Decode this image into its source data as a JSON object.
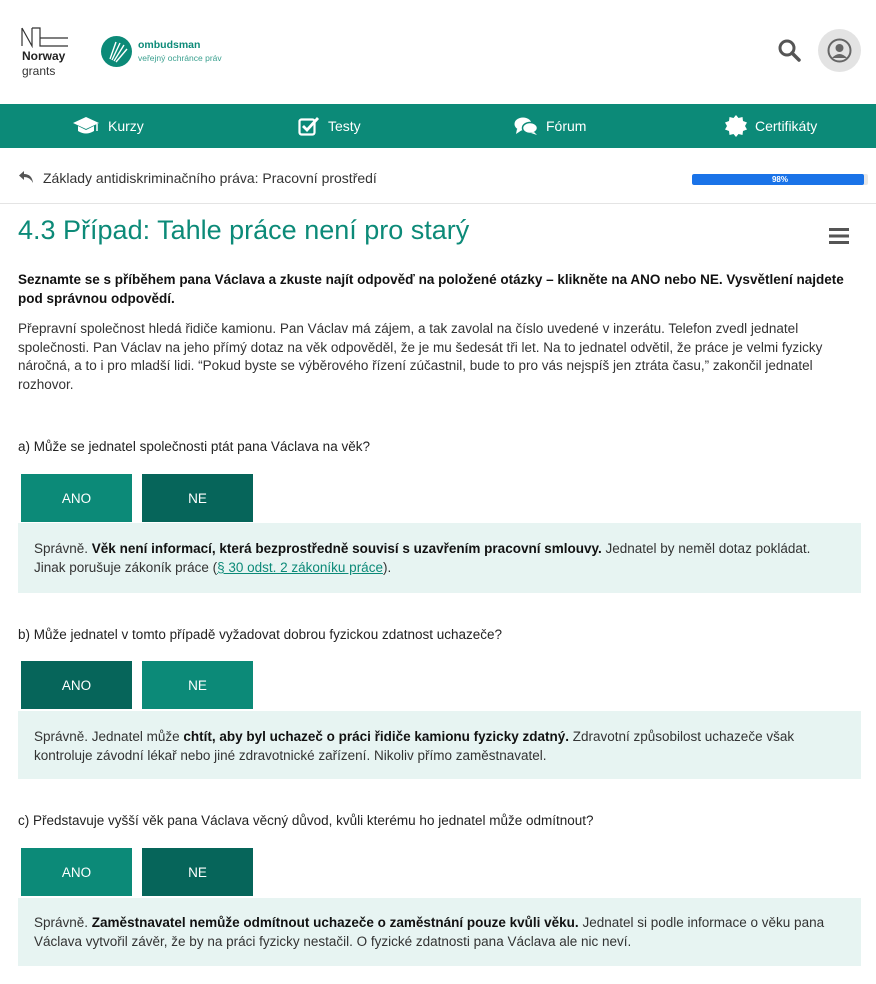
{
  "header": {
    "norway_line1": "Norway",
    "norway_line2": "grants",
    "ombudsman_title": "ombudsman",
    "ombudsman_subtitle": "veřejný ochránce práv"
  },
  "nav": [
    {
      "label": "Kurzy",
      "icon": "graduation-cap-icon"
    },
    {
      "label": "Testy",
      "icon": "checkbox-icon"
    },
    {
      "label": "Fórum",
      "icon": "chat-bubbles-icon"
    },
    {
      "label": "Certifikáty",
      "icon": "certificate-icon"
    }
  ],
  "breadcrumb": {
    "text": "Základy antidiskriminačního práva: Pracovní prostředí",
    "progress_label": "98%",
    "progress_value": 0.98
  },
  "page": {
    "title": "4.3 Případ: Tahle práce není pro starý",
    "intro": "Seznamte se s příběhem pana Václava a zkuste najít odpověď na položené otázky – klikněte na ANO nebo NE. Vysvětlení najdete pod správnou odpovědí.",
    "story": "Přepravní společnost hledá řidiče kamionu. Pan Václav má zájem, a tak zavolal na číslo uvedené v inzerátu. Telefon zvedl jednatel společnosti. Pan Václav na jeho přímý dotaz na věk odpověděl, že je mu šedesát tři let. Na to jednatel odvětil, že práce je velmi fyzicky náročná, a to i pro mladší lidi. “Pokud byste se výběrového řízení zúčastnil, bude to pro vás nejspíš jen ztráta času,” zakončil jednatel rozhovor."
  },
  "buttons": {
    "yes": "ANO",
    "no": "NE"
  },
  "questions": [
    {
      "text": "a) Může se jednatel společnosti ptát pana Václava na věk?",
      "selected": "NE",
      "answer": {
        "prefix": "Správně. ",
        "bold": "Věk není informací, která bezprostředně souvisí s uzavřením pracovní smlouvy.",
        "rest": " Jednatel by neměl dotaz pokládat. Jinak porušuje zákoník práce (",
        "link": "§ 30 odst. 2 zákoníku práce",
        "end": ")."
      }
    },
    {
      "text": "b) Může jednatel v tomto případě vyžadovat dobrou fyzickou zdatnost uchazeče?",
      "selected": "ANO",
      "answer": {
        "prefix": "Správně. Jednatel může ",
        "bold": "chtít, aby byl uchazeč o práci řidiče kamionu fyzicky zdatný.",
        "rest": " Zdravotní způsobilost uchazeče však kontroluje závodní lékař nebo jiné zdravotnické zařízení. Nikoliv přímo zaměstnavatel."
      }
    },
    {
      "text": "c) Představuje vyšší věk pana Václava věcný důvod, kvůli kterému ho jednatel může odmítnout?",
      "selected": "NE",
      "answer": {
        "prefix": "Správně. ",
        "bold": "Zaměstnavatel nemůže odmítnout uchazeče o zaměstnání pouze kvůli věku.",
        "rest": " Jednatel si podle informace o věku pana Václava vytvořil závěr, že by na práci fyzicky nestačil. O fyzické zdatnosti pana Václava ale nic neví."
      }
    }
  ],
  "colors": {
    "brand": "#0c8a78",
    "brand_dark": "#06655a",
    "answer_bg": "#e7f4f2",
    "progress": "#1a73e8"
  }
}
